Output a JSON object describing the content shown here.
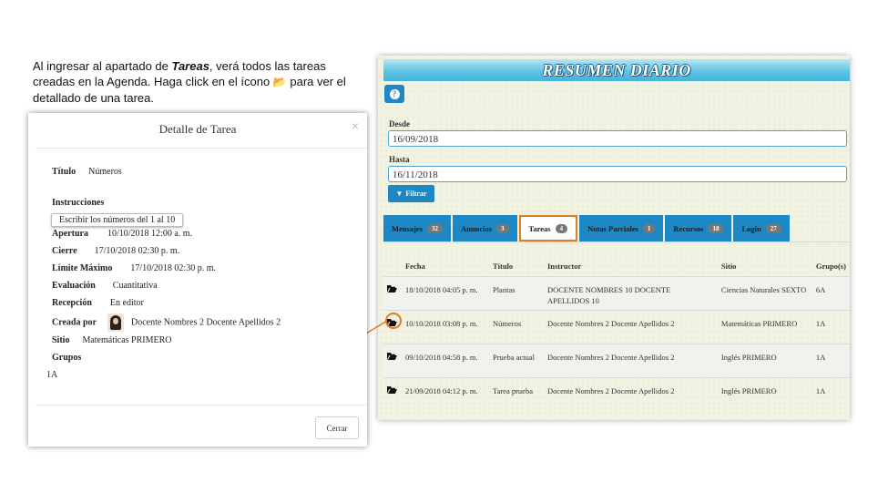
{
  "instructions": {
    "part1": "Al ingresar al apartado de ",
    "emph": "Tareas",
    "part2": ", verá todos las tareas creadas en la Agenda. Haga click en el ícono ",
    "icon": "📂",
    "part3": " para ver el detallado de una tarea."
  },
  "resumen": {
    "title": "RESUMEN DIARIO",
    "help_icon": "question-icon",
    "desde_label": "Desde",
    "desde_value": "16/09/2018",
    "hasta_label": "Hasta",
    "hasta_value": "16/11/2018",
    "filter_label": "Filtrar",
    "tabs": [
      {
        "label": "Mensajes",
        "count": "32"
      },
      {
        "label": "Anuncios",
        "count": "3"
      },
      {
        "label": "Tareas",
        "count": "4",
        "active": true
      },
      {
        "label": "Notas Parciales",
        "count": "1"
      },
      {
        "label": "Recursos",
        "count": "18"
      },
      {
        "label": "Login",
        "count": "27"
      }
    ],
    "columns": [
      "Fecha",
      "Título",
      "Instructor",
      "Sitio",
      "Grupo(s)"
    ],
    "rows": [
      {
        "fecha": "18/10/2018 04:05 p. m.",
        "titulo": "Plantas",
        "instructor": "DOCENTE NOMBRES 10 DOCENTE APELLIDOS 10",
        "sitio": "Ciencias Naturales SEXTO",
        "grupo": "6A"
      },
      {
        "fecha": "10/10/2018 03:08 p. m.",
        "titulo": "Números",
        "instructor": "Docente Nombres 2 Docente Apellidos 2",
        "sitio": "Matemáticas PRIMERO",
        "grupo": "1A"
      },
      {
        "fecha": "09/10/2018 04:58 p. m.",
        "titulo": "Prueba actual",
        "instructor": "Docente Nombres 2 Docente Apellidos 2",
        "sitio": "Inglés PRIMERO",
        "grupo": "1A"
      },
      {
        "fecha": "21/09/2018 04:12 p. m.",
        "titulo": "Tarea prueba",
        "instructor": "Docente Nombres 2 Docente Apellidos 2",
        "sitio": "Inglés PRIMERO",
        "grupo": "1A"
      }
    ]
  },
  "modal": {
    "title": "Detalle de Tarea",
    "close": "×",
    "titulo_label": "Título",
    "titulo_value": "Números",
    "instrucciones_label": "Instrucciones",
    "instrucciones_value": "Escribir los números del 1 al 10",
    "apertura_label": "Apertura",
    "apertura_value": "10/10/2018 12:00 a. m.",
    "cierre_label": "Cierre",
    "cierre_value": "17/10/2018 02:30 p. m.",
    "limite_label": "Límite Máximo",
    "limite_value": "17/10/2018 02:30 p. m.",
    "evaluacion_label": "Evaluación",
    "evaluacion_value": "Cuantitativa",
    "recepcion_label": "Recepción",
    "recepcion_value": "En editor",
    "creada_label": "Creada por",
    "creada_value": "Docente Nombres 2 Docente Apellidos 2",
    "sitio_label": "Sitio",
    "sitio_value": "Matemáticas PRIMERO",
    "grupos_label": "Grupos",
    "grupos_value": "1A",
    "cerrar_label": "Cerrar"
  },
  "colors": {
    "accent": "#1e88c5",
    "highlight": "#e07b24"
  }
}
